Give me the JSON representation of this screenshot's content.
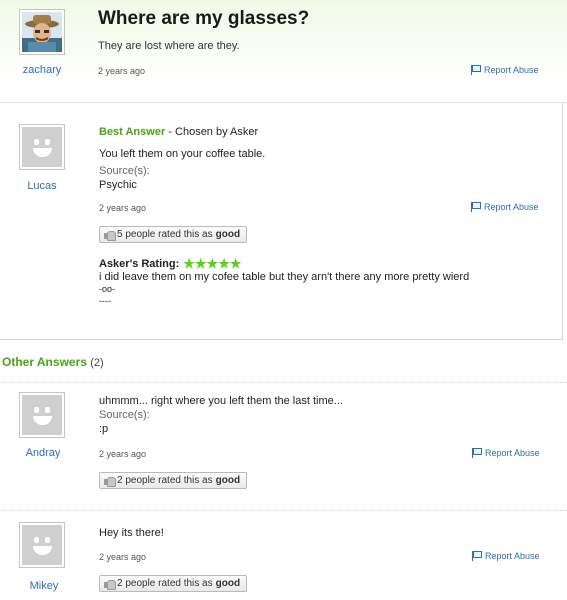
{
  "question": {
    "title": "Where are my glasses?",
    "body": "They are lost where are they.",
    "user": "zachary",
    "time": "2 years ago",
    "report": "Report Abuse"
  },
  "best_answer": {
    "heading_label": "Best Answer",
    "heading_suffix": " - Chosen by Asker",
    "text": "You left them on your coffee table.",
    "source_label": "Source(s):",
    "source": "Psychic",
    "user": "Lucas",
    "time": "2 years ago",
    "report": "Report Abuse",
    "rated_prefix": "5 people rated this as ",
    "rated_word": "good",
    "asker_rating_label": "Asker's Rating:",
    "asker_rating_stars": 5,
    "asker_rating_display": "★★★★★",
    "asker_comment_1": "i did leave them on my cofee table but they arn't there any more pretty wierd",
    "asker_comment_2": "-oo-",
    "asker_comment_3": "----"
  },
  "other_answers": {
    "heading": "Other Answers",
    "count": "(2)",
    "items": [
      {
        "user": "Andray",
        "text": "uhmmm... right where you left them the last time...",
        "source_label": "Source(s):",
        "source": ":p",
        "time": "2 years ago",
        "report": "Report Abuse",
        "rated_prefix": "2 people rated this as ",
        "rated_word": "good"
      },
      {
        "user": "Mikey",
        "text": "Hey its there!",
        "time": "2 years ago",
        "report": "Report Abuse",
        "rated_prefix": "2 people rated this as ",
        "rated_word": "good"
      }
    ]
  },
  "colors": {
    "accent_green": "#49a316",
    "link_blue": "#2d6fb4",
    "star_green": "#5ad21a"
  }
}
